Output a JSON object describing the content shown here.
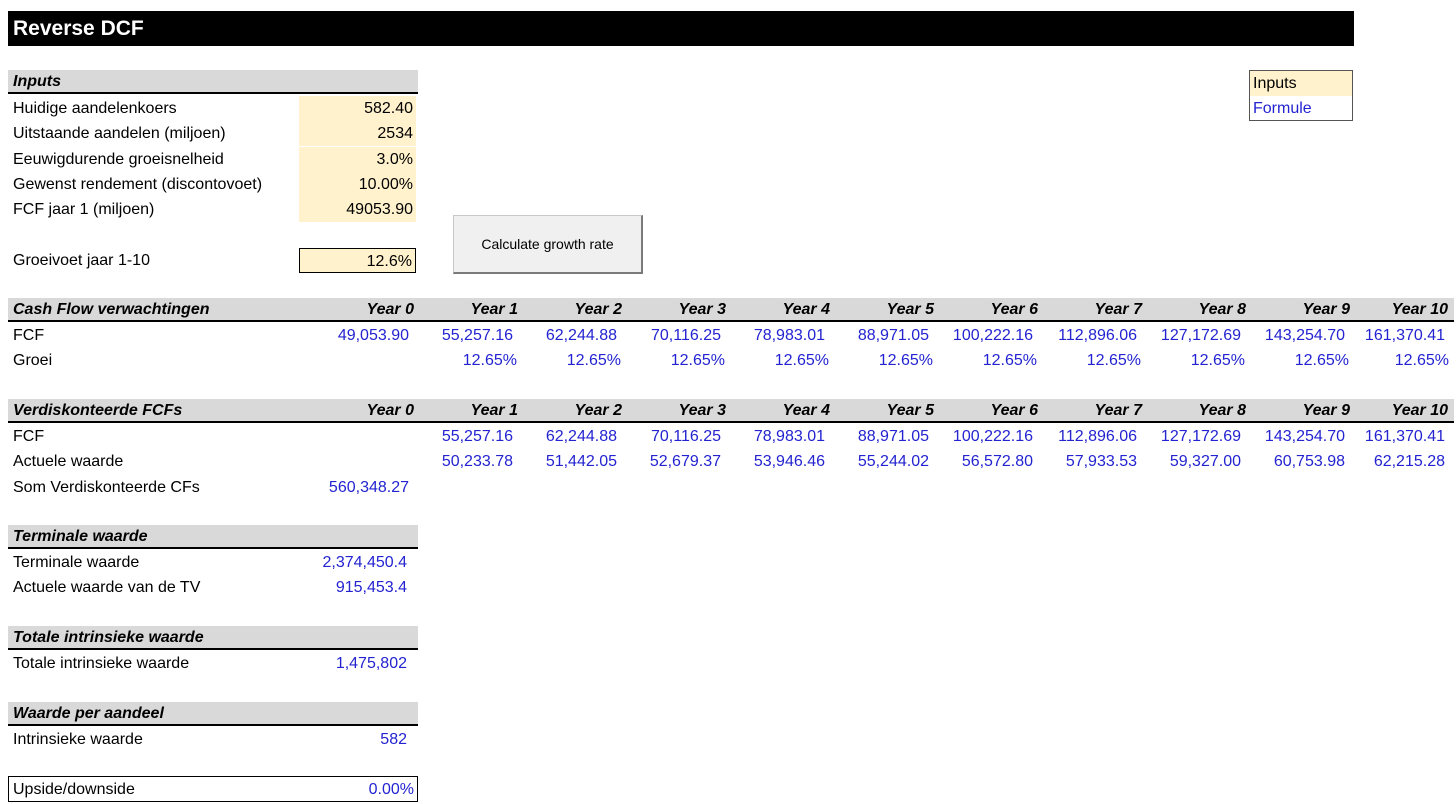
{
  "title": "Reverse DCF",
  "legend": {
    "inputs": "Inputs",
    "formula": "Formule"
  },
  "inputs": {
    "header": "Inputs",
    "rows": [
      {
        "label": "Huidige aandelenkoers",
        "value": "582.40"
      },
      {
        "label": "Uitstaande aandelen (miljoen)",
        "value": "2534"
      },
      {
        "label": "Eeuwigdurende groeisnelheid",
        "value": "3.0%"
      },
      {
        "label": "Gewenst rendement (discontovoet)",
        "value": "10.00%"
      },
      {
        "label": "FCF jaar 1 (miljoen)",
        "value": "49053.90"
      }
    ],
    "growth_label": "Groeivoet jaar 1-10",
    "growth_value": "12.6%"
  },
  "button": {
    "label": "Calculate growth rate"
  },
  "years": [
    "Year 0",
    "Year 1",
    "Year 2",
    "Year 3",
    "Year 4",
    "Year 5",
    "Year 6",
    "Year 7",
    "Year 8",
    "Year 9",
    "Year 10"
  ],
  "cashflow": {
    "header": "Cash Flow verwachtingen",
    "fcf_label": "FCF",
    "fcf": [
      "49,053.90",
      "55,257.16",
      "62,244.88",
      "70,116.25",
      "78,983.01",
      "88,971.05",
      "100,222.16",
      "112,896.06",
      "127,172.69",
      "143,254.70",
      "161,370.41"
    ],
    "growth_label": "Groei",
    "growth": [
      "",
      "12.65%",
      "12.65%",
      "12.65%",
      "12.65%",
      "12.65%",
      "12.65%",
      "12.65%",
      "12.65%",
      "12.65%",
      "12.65%"
    ]
  },
  "discounted": {
    "header": "Verdiskonteerde FCFs",
    "fcf_label": "FCF",
    "fcf": [
      "",
      "55,257.16",
      "62,244.88",
      "70,116.25",
      "78,983.01",
      "88,971.05",
      "100,222.16",
      "112,896.06",
      "127,172.69",
      "143,254.70",
      "161,370.41"
    ],
    "pv_label": "Actuele waarde",
    "pv": [
      "",
      "50,233.78",
      "51,442.05",
      "52,679.37",
      "53,946.46",
      "55,244.02",
      "56,572.80",
      "57,933.53",
      "59,327.00",
      "60,753.98",
      "62,215.28"
    ],
    "sum_label": "Som Verdiskonteerde CFs",
    "sum_value": "560,348.27"
  },
  "terminal": {
    "header": "Terminale waarde",
    "tv_label": "Terminale waarde",
    "tv_value": "2,374,450.4",
    "pv_label": "Actuele waarde van de TV",
    "pv_value": "915,453.4"
  },
  "total": {
    "header": "Totale intrinsieke waarde",
    "label": "Totale intrinsieke waarde",
    "value": "1,475,802"
  },
  "per_share": {
    "header": "Waarde per aandeel",
    "label": "Intrinsieke waarde",
    "value": "582"
  },
  "upside": {
    "label": "Upside/downside",
    "value": "0.00%"
  }
}
